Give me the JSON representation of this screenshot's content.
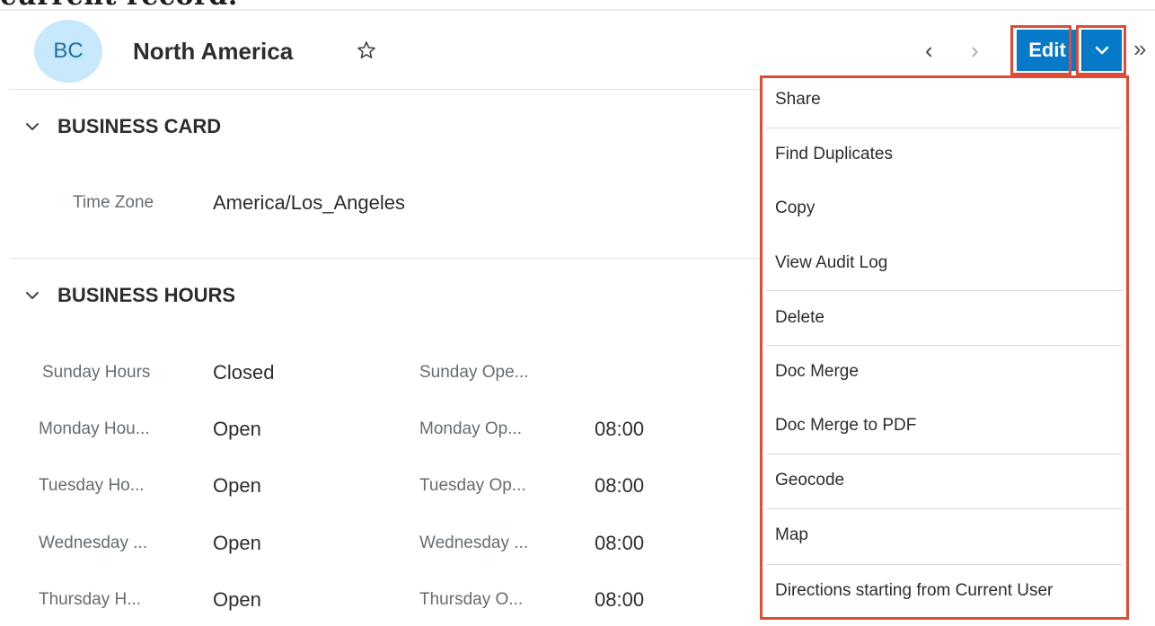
{
  "intro_text": "current record.",
  "header": {
    "avatar_initials": "BC",
    "record_name": "North America",
    "edit_label": "Edit",
    "accent_color": "#0679c8",
    "highlight_color": "#e04b35",
    "icons": {
      "favorite": "star-outline-icon",
      "prev": "chevron-left-icon",
      "next": "chevron-right-icon",
      "actions": "chevron-down-icon",
      "more": "double-chevron-right-icon"
    }
  },
  "sections": {
    "business_card": {
      "title": "BUSINESS CARD",
      "fields": [
        {
          "label": "Time Zone",
          "value": "America/Los_Angeles"
        }
      ]
    },
    "business_hours": {
      "title": "BUSINESS HOURS",
      "rows": [
        {
          "label": "Sunday Hours",
          "value": "Closed",
          "open_label": "Sunday Ope...",
          "open_value": ""
        },
        {
          "label": "Monday Hou...",
          "value": "Open",
          "open_label": "Monday Op...",
          "open_value": "08:00"
        },
        {
          "label": "Tuesday Ho...",
          "value": "Open",
          "open_label": "Tuesday Op...",
          "open_value": "08:00"
        },
        {
          "label": "Wednesday ...",
          "value": "Open",
          "open_label": "Wednesday ...",
          "open_value": "08:00"
        },
        {
          "label": "Thursday H...",
          "value": "Open",
          "open_label": "Thursday O...",
          "open_value": "08:00"
        }
      ]
    }
  },
  "actions_menu": {
    "items": [
      "Share",
      "Find Duplicates",
      "Copy",
      "View Audit Log",
      "Delete",
      "Doc Merge",
      "Doc Merge to PDF",
      "Geocode",
      "Map",
      "Directions starting from Current User"
    ]
  }
}
